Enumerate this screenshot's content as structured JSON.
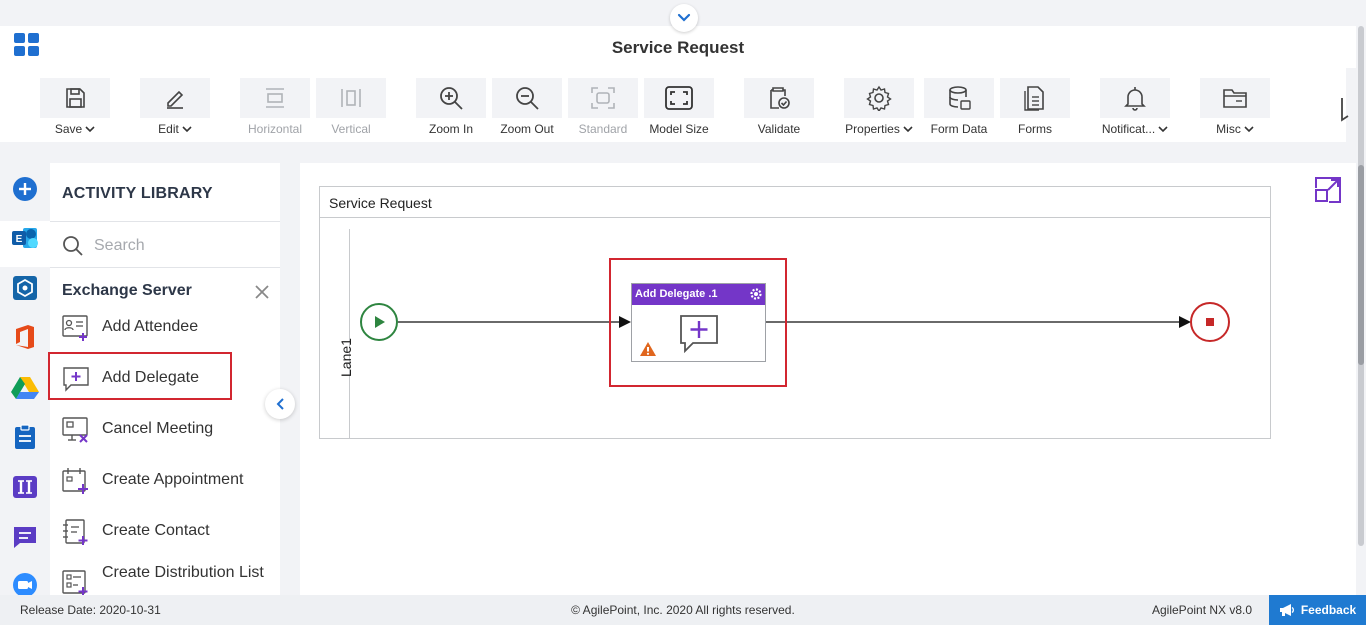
{
  "header": {
    "title": "Service Request"
  },
  "toolbar": {
    "save": "Save",
    "edit": "Edit",
    "horizontal": "Horizontal",
    "vertical": "Vertical",
    "zoom_in": "Zoom In",
    "zoom_out": "Zoom Out",
    "standard": "Standard",
    "model_size": "Model Size",
    "validate": "Validate",
    "properties": "Properties",
    "form_data": "Form Data",
    "forms": "Forms",
    "notifications": "Notificat...",
    "misc": "Misc"
  },
  "library": {
    "title": "ACTIVITY LIBRARY",
    "search_placeholder": "Search",
    "category": "Exchange Server",
    "items": [
      {
        "label": "Add Attendee"
      },
      {
        "label": "Add Delegate"
      },
      {
        "label": "Cancel Meeting"
      },
      {
        "label": "Create Appointment"
      },
      {
        "label": "Create Contact"
      },
      {
        "label": "Create Distribution List"
      }
    ]
  },
  "canvas": {
    "pool_title": "Service Request",
    "lane_label": "Lane1",
    "task_title": "Add Delegate .1"
  },
  "footer": {
    "release_date": "Release Date: 2020-10-31",
    "copyright": "© AgilePoint, Inc. 2020 All rights reserved.",
    "version": "AgilePoint NX v8.0",
    "feedback": "Feedback"
  },
  "colors": {
    "accent_purple": "#7436c8",
    "highlight_red": "#d22630",
    "start_green": "#2e8540",
    "end_red": "#c62828",
    "feedback_blue": "#1f7ad1"
  }
}
